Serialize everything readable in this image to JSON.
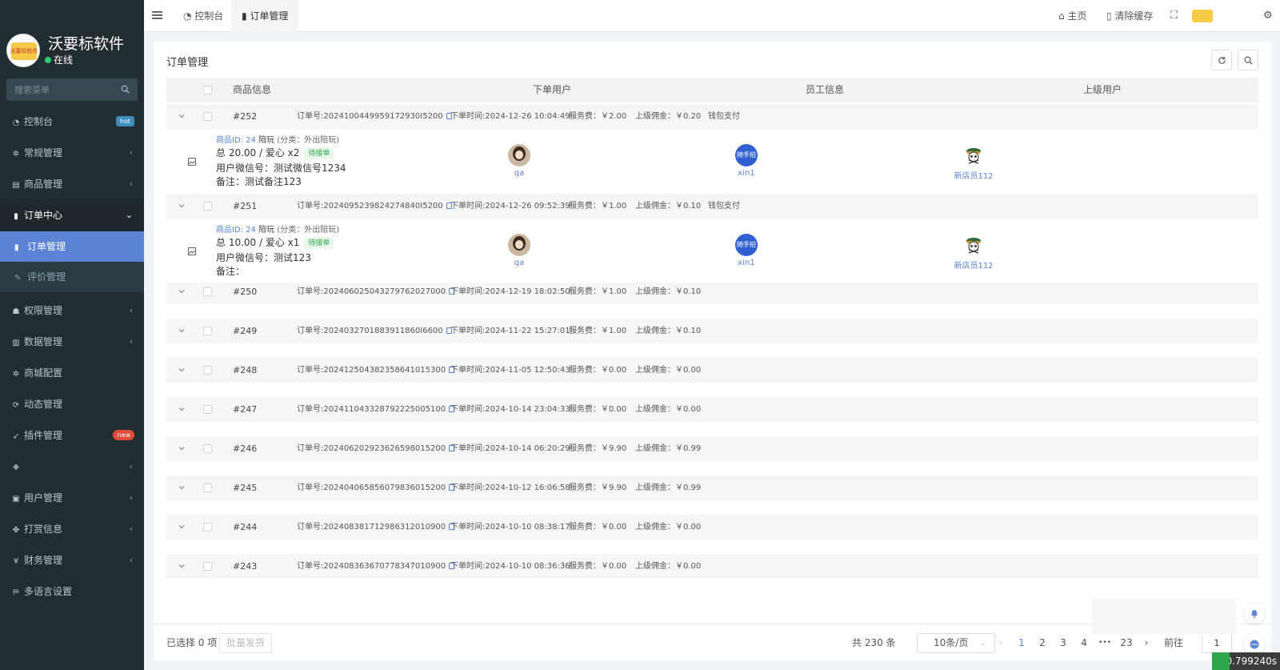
{
  "sidebar": {
    "brand_name": "沃要标软件",
    "logo_text": "沃要标软件",
    "status": "在线",
    "search_placeholder": "搜索菜单",
    "items": [
      {
        "label": "控制台",
        "icon": "dashboard-icon",
        "badge": "hot",
        "badge_color": "#3c8dbc"
      },
      {
        "label": "常规管理",
        "icon": "cogs-icon"
      },
      {
        "label": "商品管理",
        "icon": "archive-icon"
      },
      {
        "label": "订单中心",
        "icon": "file-icon"
      },
      {
        "label": "权限管理",
        "icon": "group-icon"
      },
      {
        "label": "数据管理",
        "icon": "bar-chart-icon"
      },
      {
        "label": "商城配置",
        "icon": "cogs-icon"
      },
      {
        "label": "动态管理",
        "icon": "retweet-icon"
      },
      {
        "label": "插件管理",
        "icon": "rocket-icon",
        "badge": "new",
        "badge_color": "#dd4b39"
      },
      {
        "label": "",
        "icon": "dropbox-icon"
      },
      {
        "label": "用户管理",
        "icon": "id-card-icon"
      },
      {
        "label": "打赏信息",
        "icon": "gift-icon"
      },
      {
        "label": "财务管理",
        "icon": "yen-icon"
      },
      {
        "label": "多语言设置",
        "icon": "language-icon"
      }
    ],
    "submenu": [
      {
        "label": "订单管理",
        "icon": "file-icon"
      },
      {
        "label": "评价管理",
        "icon": "edit-icon"
      }
    ]
  },
  "topbar": {
    "tabs": [
      "控制台",
      "订单管理"
    ],
    "home": "主页",
    "clear_cache": "清除缓存"
  },
  "card": {
    "title": "订单管理",
    "headers": [
      "商品信息",
      "下单用户",
      "员工信息",
      "上级用户"
    ]
  },
  "orders": [
    {
      "id": "#252",
      "order_no": "订单号:2024100449959172930I5200",
      "time": "下单时间:2024-12-26 10:04:49",
      "fee": "服务费：￥2.00",
      "commission": "上级佣金：￥0.20",
      "pay": "钱包支付"
    },
    {
      "id": "#251",
      "order_no": "订单号:2024095239824274840I5200",
      "time": "下单时间:2024-12-26 09:52:39",
      "fee": "服务费：￥1.00",
      "commission": "上级佣金：￥0.10",
      "pay": "钱包支付"
    },
    {
      "id": "#250",
      "order_no": "订单号:2024060250432797620270​00",
      "time": "下单时间:2024-12-19 18:02:50",
      "fee": "服务费：￥1.00",
      "commission": "上级佣金：￥0.10",
      "pay": ""
    },
    {
      "id": "#249",
      "order_no": "订单号:2024032701883911860I6600",
      "time": "下单时间:2024-11-22 15:27:01",
      "fee": "服务费：￥1.00",
      "commission": "上级佣金：￥0.10",
      "pay": ""
    },
    {
      "id": "#248",
      "order_no": "订单号:20241250438235864101530​0",
      "time": "下单时间:2024-11-05 12:50:43",
      "fee": "服务费：￥0.00",
      "commission": "上级佣金：￥0.00",
      "pay": ""
    },
    {
      "id": "#247",
      "order_no": "订单号:2024110433287922250051​00",
      "time": "下单时间:2024-10-14 23:04:33",
      "fee": "服务费：￥0.00",
      "commission": "上级佣金：￥0.00",
      "pay": ""
    },
    {
      "id": "#246",
      "order_no": "订单号:2024062029236265980152​00",
      "time": "下单时间:2024-10-14 06:20:29",
      "fee": "服务费：￥9.90",
      "commission": "上级佣金：￥0.99",
      "pay": ""
    },
    {
      "id": "#245",
      "order_no": "订单号:2024040658560798360152​00",
      "time": "下单时间:2024-10-12 16:06:58",
      "fee": "服务费：￥9.90",
      "commission": "上级佣金：￥0.99",
      "pay": ""
    },
    {
      "id": "#244",
      "order_no": "订单号:2024083817129863120109​00",
      "time": "下单时间:2024-10-10 08:38:17",
      "fee": "服务费：￥0.00",
      "commission": "上级佣金：￥0.00",
      "pay": ""
    },
    {
      "id": "#243",
      "order_no": "订单号:2024083636707783470109​00",
      "time": "下单时间:2024-10-10 08:36:36",
      "fee": "服务费：￥0.00",
      "commission": "上级佣金：￥0.00",
      "pay": ""
    }
  ],
  "details": [
    {
      "product_id": "商品ID: 24",
      "product_name": "陪玩",
      "category": "(分类：外出陪玩)",
      "total": "总 20.00 / 爱心 x2",
      "status": "待接单",
      "wechat": "用户微信号：测试微信号1234",
      "remark": "备注：测试备注123",
      "buyer": "qa",
      "staff": "xin1",
      "staff_avatar_text": "随手拍",
      "parent": "新店员112"
    },
    {
      "product_id": "商品ID: 24",
      "product_name": "陪玩",
      "category": "(分类：外出陪玩)",
      "total": "总 10.00 / 爱心 x1",
      "status": "待接单",
      "wechat": "用户微信号：测试123",
      "remark": "备注：",
      "buyer": "qa",
      "staff": "xin1",
      "staff_avatar_text": "随手拍",
      "parent": "新店员112"
    }
  ],
  "footer": {
    "selected": "已选择 0 项",
    "batch": "批量发货",
    "total": "共 230 条",
    "per_page": "10条/页",
    "pages": [
      "1",
      "2",
      "3",
      "4",
      "•••",
      "23"
    ],
    "goto_label": "前往",
    "goto_value": "1"
  },
  "timer": "0.799240s"
}
